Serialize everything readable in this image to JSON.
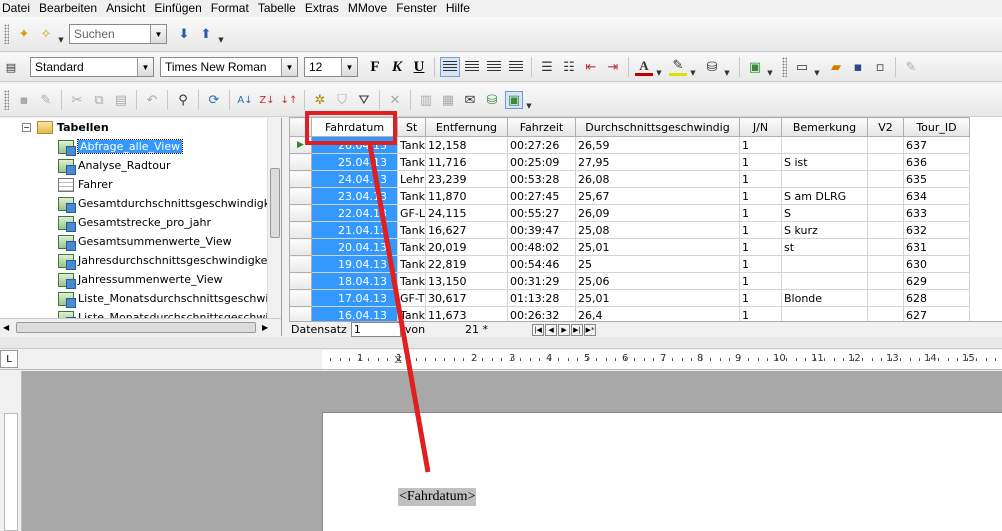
{
  "menu": [
    "Datei",
    "Bearbeiten",
    "Ansicht",
    "Einfügen",
    "Format",
    "Tabelle",
    "Extras",
    "MMove",
    "Fenster",
    "Hilfe"
  ],
  "toolbar1": {
    "search_placeholder": "Suchen"
  },
  "toolbar2": {
    "paragraph_style": "Standard",
    "font_name": "Times New Roman",
    "font_size": "12",
    "bold": "F",
    "italic": "K",
    "underline": "U"
  },
  "tree": {
    "root": "Tabellen",
    "items": [
      {
        "label": "Abfrage_alle_View",
        "selected": true
      },
      {
        "label": "Analyse_Radtour"
      },
      {
        "label": "Fahrer"
      },
      {
        "label": "Gesamtdurchschnittsgeschwindigke"
      },
      {
        "label": "Gesamtstrecke_pro_jahr"
      },
      {
        "label": "Gesamtsummenwerte_View"
      },
      {
        "label": "Jahresdurchschnittsgeschwindigkei"
      },
      {
        "label": "Jahressummenwerte_View"
      },
      {
        "label": "Liste_Monatsdurchschnittsgeschwir"
      },
      {
        "label": "Liste_Monatsdurchschnittsgeschwir"
      }
    ]
  },
  "grid": {
    "columns": [
      "Fahrdatum",
      "St",
      "Entfernung",
      "Fahrzeit",
      "Durchschnittsgeschwindig",
      "J/N",
      "Bemerkung",
      "V2",
      "Tour_ID"
    ],
    "rows": [
      [
        "26.04.13",
        "Tank",
        "12,158",
        "00:27:26",
        "26,59",
        "1",
        "",
        "",
        "637"
      ],
      [
        "25.04.13",
        "Tank",
        "11,716",
        "00:25:09",
        "27,95",
        "1",
        "S ist",
        "",
        "636"
      ],
      [
        "24.04.13",
        "Lehr",
        "23,239",
        "00:53:28",
        "26,08",
        "1",
        "",
        "",
        "635"
      ],
      [
        "23.04.13",
        "Tank",
        "11,870",
        "00:27:45",
        "25,67",
        "1",
        "S am DLRG",
        "",
        "634"
      ],
      [
        "22.04.13",
        "GF-L",
        "24,115",
        "00:55:27",
        "26,09",
        "1",
        "S",
        "",
        "633"
      ],
      [
        "21.04.13",
        "Tank",
        "16,627",
        "00:39:47",
        "25,08",
        "1",
        "S kurz",
        "",
        "632"
      ],
      [
        "20.04.13",
        "Tank",
        "20,019",
        "00:48:02",
        "25,01",
        "1",
        "st",
        "",
        "631"
      ],
      [
        "19.04.13",
        "Tank",
        "22,819",
        "00:54:46",
        "25",
        "1",
        "",
        "",
        "630"
      ],
      [
        "18.04.13",
        "Tank",
        "13,150",
        "00:31:29",
        "25,06",
        "1",
        "",
        "",
        "629"
      ],
      [
        "17.04.13",
        "GF-T",
        "30,617",
        "01:13:28",
        "25,01",
        "1",
        "Blonde",
        "",
        "628"
      ],
      [
        "16.04.13",
        "Tank",
        "11,673",
        "00:26:32",
        "26,4",
        "1",
        "",
        "",
        "627"
      ]
    ]
  },
  "navbar": {
    "label": "Datensatz",
    "current": "1",
    "of": "von",
    "total": "21 *"
  },
  "ruler": [
    "1",
    "1",
    "2",
    "3",
    "4",
    "5",
    "6",
    "7",
    "8",
    "9",
    "10",
    "11",
    "12",
    "13",
    "14",
    "15"
  ],
  "document": {
    "field": "<Fahrdatum>"
  },
  "colors": {
    "selection": "#3399ff",
    "annotation": "#e02020"
  }
}
